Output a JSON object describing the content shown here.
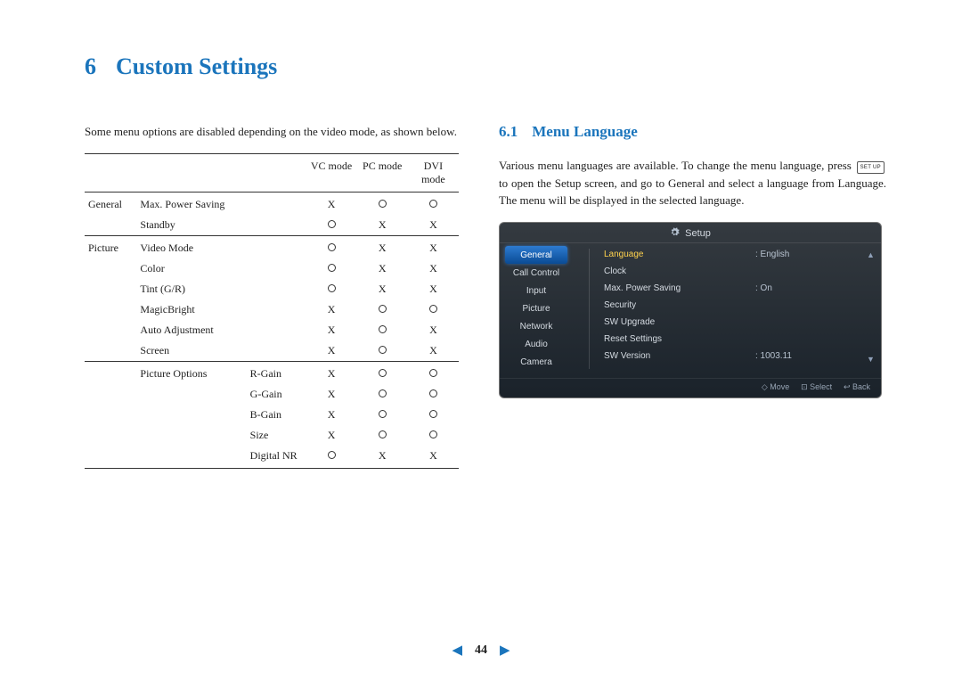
{
  "chapter": {
    "num": "6",
    "title": "Custom Settings"
  },
  "section": {
    "num": "6.1",
    "title": "Menu Language"
  },
  "left_intro": "Some menu options are disabled depending on the video mode, as shown below.",
  "table": {
    "cols": [
      "VC mode",
      "PC mode",
      "DVI mode"
    ],
    "groups": [
      {
        "category": "General",
        "rows": [
          {
            "item": "Max. Power Saving",
            "sub": "",
            "marks": [
              "X",
              "O",
              "O"
            ]
          },
          {
            "item": "Standby",
            "sub": "",
            "marks": [
              "O",
              "X",
              "X"
            ]
          }
        ]
      },
      {
        "category": "Picture",
        "rows": [
          {
            "item": "Video Mode",
            "sub": "",
            "marks": [
              "O",
              "X",
              "X"
            ]
          },
          {
            "item": "Color",
            "sub": "",
            "marks": [
              "O",
              "X",
              "X"
            ]
          },
          {
            "item": "Tint (G/R)",
            "sub": "",
            "marks": [
              "O",
              "X",
              "X"
            ]
          },
          {
            "item": "MagicBright",
            "sub": "",
            "marks": [
              "X",
              "O",
              "O"
            ]
          },
          {
            "item": "Auto Adjustment",
            "sub": "",
            "marks": [
              "X",
              "O",
              "X"
            ]
          },
          {
            "item": "Screen",
            "sub": "",
            "marks": [
              "X",
              "O",
              "X"
            ]
          }
        ]
      },
      {
        "category": "",
        "rows": [
          {
            "item": "Picture Options",
            "sub": "R-Gain",
            "marks": [
              "X",
              "O",
              "O"
            ]
          },
          {
            "item": "",
            "sub": "G-Gain",
            "marks": [
              "X",
              "O",
              "O"
            ]
          },
          {
            "item": "",
            "sub": "B-Gain",
            "marks": [
              "X",
              "O",
              "O"
            ]
          },
          {
            "item": "",
            "sub": "Size",
            "marks": [
              "X",
              "O",
              "O"
            ]
          },
          {
            "item": "",
            "sub": "Digital NR",
            "marks": [
              "O",
              "X",
              "X"
            ]
          }
        ]
      }
    ]
  },
  "right_para_before_key": "Various menu languages are available. To change the menu language, press ",
  "setup_key_label": "SET UP",
  "right_para_after_key": " to open the Setup screen, and go to General and select a language from Language. The menu will be displayed in the selected language.",
  "osd": {
    "title": "Setup",
    "side": [
      "General",
      "Call Control",
      "Input",
      "Picture",
      "Network",
      "Audio",
      "Camera"
    ],
    "active_side_index": 0,
    "main": [
      {
        "label": "Language",
        "value": ": English",
        "selected": true
      },
      {
        "label": "Clock",
        "value": ""
      },
      {
        "label": "Max. Power Saving",
        "value": ": On"
      },
      {
        "label": "Security",
        "value": ""
      },
      {
        "label": "SW Upgrade",
        "value": ""
      },
      {
        "label": "Reset Settings",
        "value": ""
      },
      {
        "label": "SW Version",
        "value": ": 1003.11"
      }
    ],
    "foot": {
      "move": "Move",
      "select": "Select",
      "back": "Back"
    }
  },
  "page_nav": {
    "prev": "◀",
    "page": "44",
    "next": "▶"
  }
}
